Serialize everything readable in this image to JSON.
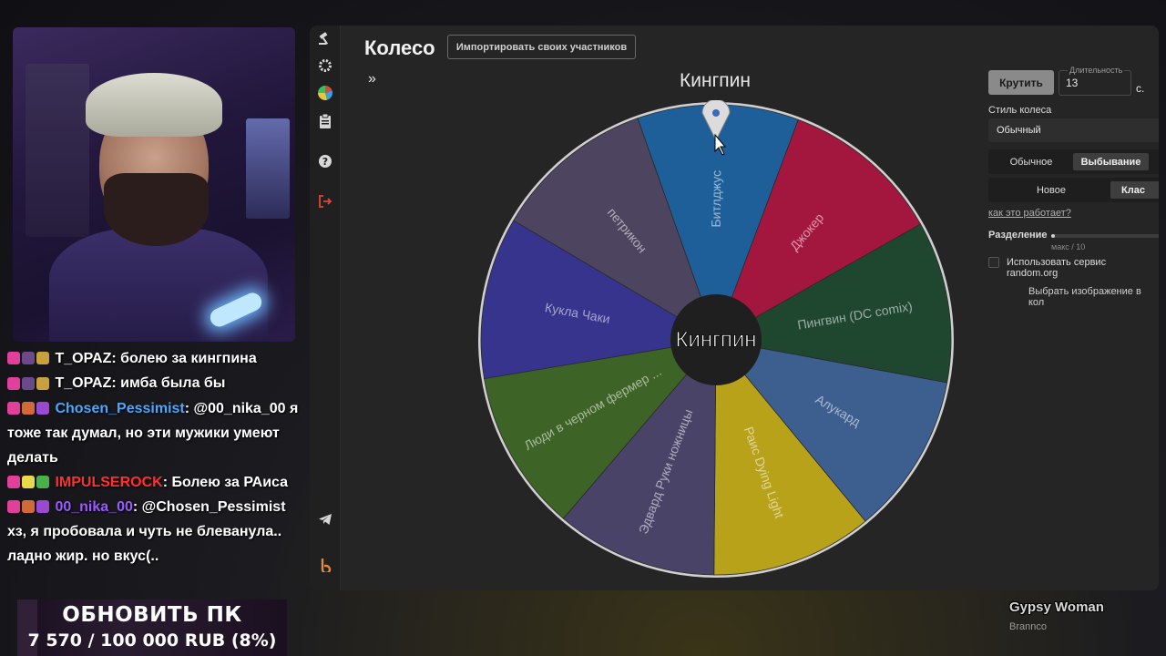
{
  "chat": [
    {
      "user": "T_OPAZ",
      "user_color": "#ffffff",
      "message": "болею за кингпина",
      "badges": [
        "#e0409a",
        "#6a4a8a",
        "#c8a040"
      ]
    },
    {
      "user": "T_OPAZ",
      "user_color": "#ffffff",
      "message": "имба была бы",
      "badges": [
        "#e0409a",
        "#6a4a8a",
        "#c8a040"
      ]
    },
    {
      "user": "Chosen_Pessimist",
      "user_color": "#4aa8ff",
      "message": "@00_nika_00 я тоже так думал, но эти мужики умеют делать",
      "badges": [
        "#e0409a",
        "#d06a3a",
        "#9a4ad0"
      ]
    },
    {
      "user": "IMPULSEROCK",
      "user_color": "#ff3030",
      "message": "Болею за РАиса",
      "badges": [
        "#e0409a",
        "#e8d84a",
        "#4ab04a"
      ]
    },
    {
      "user": "00_nika_00",
      "user_color": "#9a5aff",
      "message": "@Chosen_Pessimist хз, я пробовала и чуть не блеванула.. ладно жир. но вкус(..",
      "badges": [
        "#e0409a",
        "#d06a3a",
        "#9a4ad0"
      ]
    }
  ],
  "goal": {
    "title": "ОБНОВИТЬ ПК",
    "amount": "7 570 / 100 000 RUB (8%)",
    "progress": 0.0757
  },
  "app": {
    "title": "Колесо",
    "import_button": "Импортировать своих участников",
    "expand_icon": "»",
    "winner": "Кингпин",
    "center_label": "Кингпин",
    "spin_button": "Крутить",
    "duration_label": "Длительность",
    "duration_value": "13",
    "duration_unit": "с.",
    "style_label": "Стиль колеса",
    "style_value": "Обычный",
    "mode_options": [
      "Обычное",
      "Выбывание"
    ],
    "mode_active": "Выбывание",
    "variant_options": [
      "Новое",
      "Клас"
    ],
    "variant_active": "Клас",
    "how_link": "как это работает?",
    "split_label": "Разделение",
    "split_hint": "макс / 10",
    "random_org_label": "Использовать сервис random.org",
    "image_label": "Выбрать изображение в кол",
    "side_icons": [
      "gavel-icon",
      "gear-icon",
      "pie-chart-icon",
      "clipboard-icon",
      "help-icon",
      "logout-icon",
      "telegram-icon",
      "brand-icon"
    ]
  },
  "wheel": {
    "segments": [
      {
        "label": "Битлджус",
        "color": "#1e5f99"
      },
      {
        "label": "Джокер",
        "color": "#a3173f"
      },
      {
        "label": "Пингвин (DC comix)",
        "color": "#1f4730"
      },
      {
        "label": "Алукард",
        "color": "#3d5f8f"
      },
      {
        "label": "Раис Dying Light",
        "color": "#b8a21a"
      },
      {
        "label": "Эдвард Руки ножницы",
        "color": "#4a4368"
      },
      {
        "label": "Люди в черном фермер ...",
        "color": "#3e6326"
      },
      {
        "label": "Кукла Чаки",
        "color": "#36348c"
      },
      {
        "label": "петрикон",
        "color": "#4d4560"
      }
    ],
    "start_angle_deg": -19.5,
    "span_deg": 40
  },
  "now_playing": {
    "title": "Gypsy Woman",
    "artist": "Brannco"
  }
}
